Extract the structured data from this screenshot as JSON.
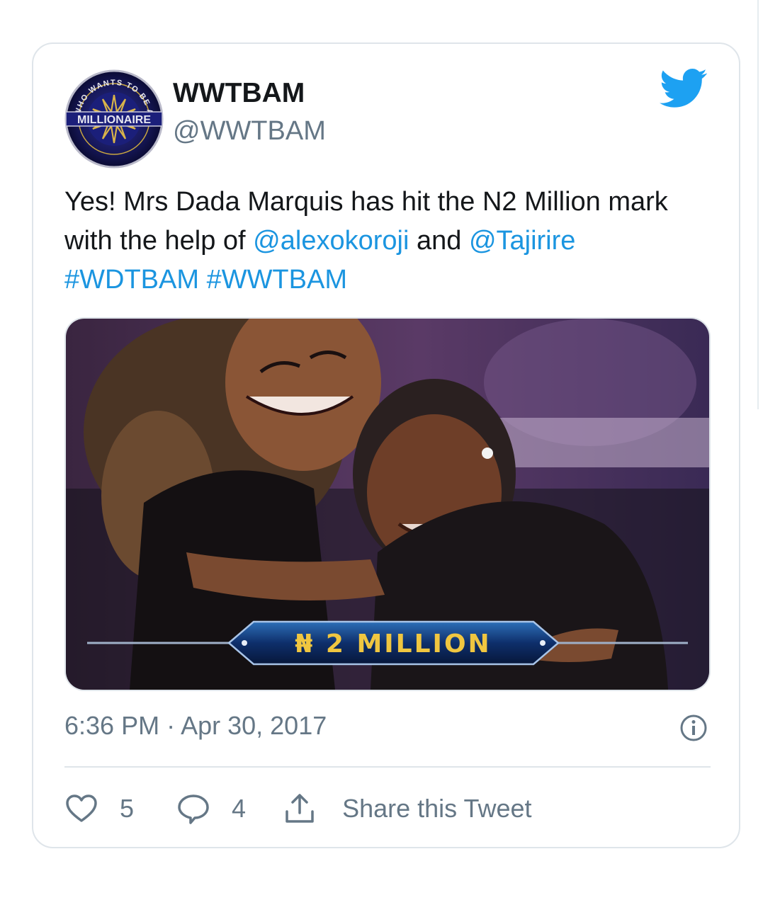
{
  "author": {
    "name": "WWTBAM",
    "handle": "@WWTBAM",
    "avatar_text": [
      "WHO WANTS TO BE A",
      "MILLIONAIRE"
    ],
    "avatar_icon": "millionaire-logo"
  },
  "tweet": {
    "text_prefix": "Yes! Mrs Dada Marquis has hit the N2 Million mark with the help of ",
    "mention1": "@alexokoroji",
    "text_and": " and ",
    "mention2": "@Tajirire",
    "hashtag1": "#WDTBAM",
    "hashtag2": "#WWTBAM"
  },
  "media": {
    "banner_text": "₦ 2 MILLION",
    "description_icon": "photo-two-women-hugging"
  },
  "meta": {
    "timestamp": "6:36 PM · Apr 30, 2017"
  },
  "actions": {
    "like_count": "5",
    "reply_count": "4",
    "share_label": "Share this Tweet"
  },
  "colors": {
    "link": "#1b95e0",
    "twitter_blue": "#1da1f2",
    "muted": "#657786",
    "border": "#dfe5ea"
  }
}
